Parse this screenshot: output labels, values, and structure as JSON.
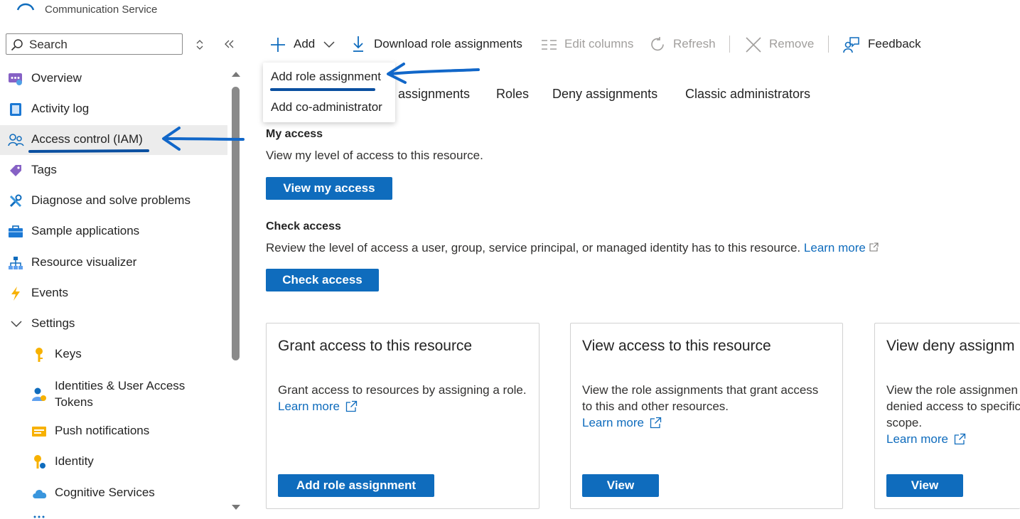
{
  "header": {
    "subtitle": "Communication Service"
  },
  "sidebar": {
    "search_placeholder": "Search",
    "items": [
      {
        "label": "Overview",
        "icon": "overview-icon"
      },
      {
        "label": "Activity log",
        "icon": "activity-log-icon"
      },
      {
        "label": "Access control (IAM)",
        "icon": "access-control-icon",
        "selected": true
      },
      {
        "label": "Tags",
        "icon": "tag-icon"
      },
      {
        "label": "Diagnose and solve problems",
        "icon": "wrench-icon"
      },
      {
        "label": "Sample applications",
        "icon": "briefcase-icon"
      },
      {
        "label": "Resource visualizer",
        "icon": "hierarchy-icon"
      },
      {
        "label": "Events",
        "icon": "lightning-icon"
      },
      {
        "label": "Settings",
        "icon": "chevron-down-icon"
      },
      {
        "label": "Keys",
        "icon": "key-icon"
      },
      {
        "label": "Identities & User Access",
        "label2": "Tokens",
        "icon": "identity-user-icon"
      },
      {
        "label": "Push notifications",
        "icon": "push-notification-icon"
      },
      {
        "label": "Identity",
        "icon": "identity-key-icon"
      },
      {
        "label": "Cognitive Services",
        "icon": "cloud-icon"
      }
    ]
  },
  "toolbar": {
    "add": "Add",
    "download": "Download role assignments",
    "edit_columns": "Edit columns",
    "refresh": "Refresh",
    "remove": "Remove",
    "feedback": "Feedback"
  },
  "add_menu": {
    "items": [
      "Add role assignment",
      "Add co-administrator"
    ]
  },
  "tabs": [
    "assignments",
    "Roles",
    "Deny assignments",
    "Classic administrators"
  ],
  "my_access": {
    "title": "My access",
    "description": "View my level of access to this resource.",
    "button": "View my access"
  },
  "check_access": {
    "title": "Check access",
    "description": "Review the level of access a user, group, service principal, or managed identity has to this resource.",
    "link": "Learn more",
    "button": "Check access"
  },
  "cards": [
    {
      "title": "Grant access to this resource",
      "lines": [
        "Grant access to resources by assigning a role."
      ],
      "link": "Learn more",
      "button": "Add role assignment"
    },
    {
      "title": "View access to this resource",
      "lines": [
        "View the role assignments that grant access",
        "to this and other resources."
      ],
      "link": "Learn more",
      "button": "View"
    },
    {
      "title": "View deny assignm",
      "lines": [
        "View the role assignmen",
        "denied access to specific",
        "scope."
      ],
      "link": "Learn more",
      "button": "View"
    }
  ],
  "colors": {
    "accent": "#0f6cbd",
    "annotation": "#1167c9"
  }
}
